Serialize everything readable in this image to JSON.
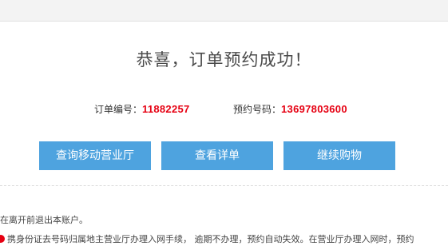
{
  "headline": "恭喜，订单预约成功！",
  "order": {
    "number_label": "订单编号：",
    "number_value": "11882257",
    "phone_label": "预约号码：",
    "phone_value": "13697803600"
  },
  "buttons": {
    "find_store": "查询移动营业厅",
    "view_details": "查看详单",
    "continue_shopping": "继续购物"
  },
  "notes": {
    "logout_hint": "在离开前退出本账户。",
    "id_hint": "携身份证去号码归属地主营业厅办理入网手续， 逾期不办理，预约自动失效。在营业厅办理入网时，预约"
  },
  "colors": {
    "accent_button": "#4ea3df",
    "highlight_value": "#e60012",
    "alert_icon": "#e60012"
  }
}
